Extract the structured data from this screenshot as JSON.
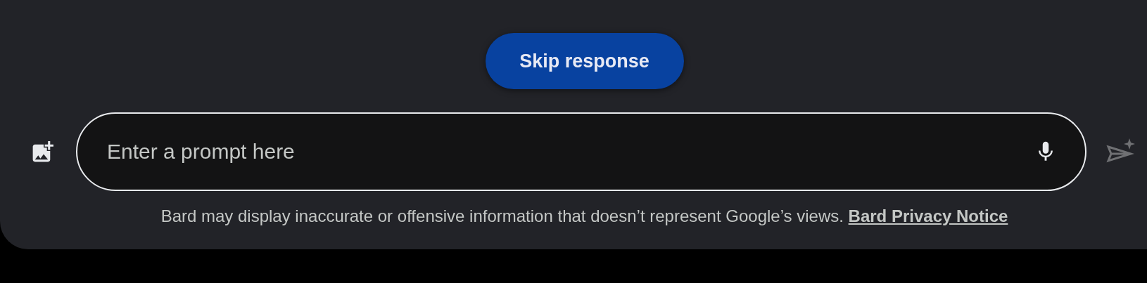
{
  "skip_button": {
    "label": "Skip response"
  },
  "prompt": {
    "placeholder": "Enter a prompt here"
  },
  "send_button": {
    "disabled": true
  },
  "disclaimer": {
    "text": "Bard may display inaccurate or offensive information that doesn’t represent Google’s views.",
    "link": "Bard Privacy Notice"
  }
}
